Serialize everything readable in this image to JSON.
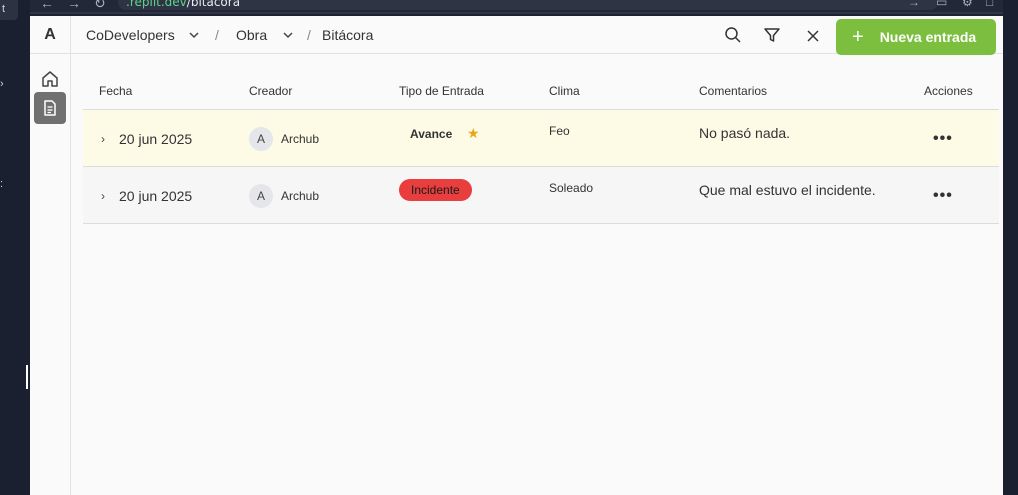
{
  "browser": {
    "url_host": ".replit.dev",
    "url_path": "/bitacora"
  },
  "sidebar": {
    "logo": "A",
    "items": [
      {
        "name": "home",
        "icon": "home-icon",
        "active": false
      },
      {
        "name": "bitacora",
        "icon": "document-icon",
        "active": true
      }
    ]
  },
  "breadcrumb": {
    "org": "CoDevelopers",
    "project": "Obra",
    "page": "Bitácora",
    "separator": "/"
  },
  "toolbar": {
    "search_icon": "search-icon",
    "filter_icon": "filter-icon",
    "clear_icon": "close-icon",
    "new_button": "Nueva entrada",
    "new_button_icon": "+",
    "accent_color": "#7cbf3f"
  },
  "table": {
    "columns": [
      "Fecha",
      "Creador",
      "Tipo de Entrada",
      "Clima",
      "Comentarios",
      "Acciones"
    ],
    "rows": [
      {
        "fecha": "20 jun 2025",
        "avatar": "A",
        "creador": "Archub",
        "tipo": "Avance",
        "starred": true,
        "clima": "Feo",
        "comentarios": "No pasó nada.",
        "acciones": "•••"
      },
      {
        "fecha": "20 jun 2025",
        "avatar": "A",
        "creador": "Archub",
        "tipo": "Incidente",
        "tipo_color": "#e83e3e",
        "clima": "Soleado",
        "comentarios": "Que mal estuvo el incidente.",
        "acciones": "•••"
      }
    ]
  }
}
